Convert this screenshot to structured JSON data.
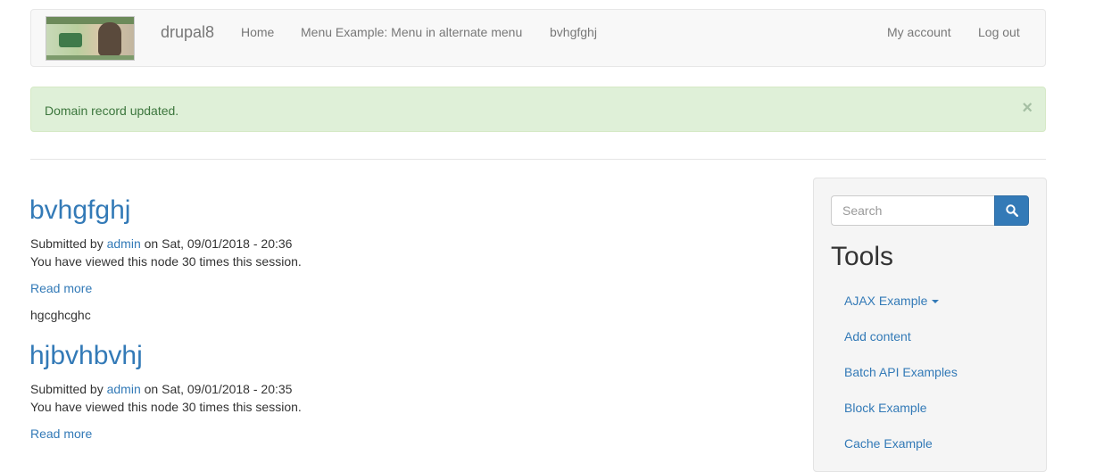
{
  "navbar": {
    "brand": "drupal8",
    "links": [
      "Home",
      "Menu Example: Menu in alternate menu",
      "bvhgfghj"
    ],
    "account_links": [
      "My account",
      "Log out"
    ]
  },
  "alert": {
    "message": "Domain record updated.",
    "close": "×"
  },
  "nodes": [
    {
      "title": "bvhgfghj",
      "submitted_prefix": "Submitted by ",
      "author": "admin",
      "submitted_suffix": " on Sat, 09/01/2018 - 20:36",
      "views": "You have viewed this node 30 times this session.",
      "read_more": "Read more",
      "body": "hgcghcghc"
    },
    {
      "title": "hjbvhbvhj",
      "submitted_prefix": "Submitted by ",
      "author": "admin",
      "submitted_suffix": " on Sat, 09/01/2018 - 20:35",
      "views": "You have viewed this node 30 times this session.",
      "read_more": "Read more"
    }
  ],
  "sidebar": {
    "search_placeholder": "Search",
    "search_icon": "search-icon",
    "tools_heading": "Tools",
    "tools": [
      "AJAX Example",
      "Add content",
      "Batch API Examples",
      "Block Example",
      "Cache Example"
    ]
  },
  "colors": {
    "link": "#337ab7",
    "navbar_bg": "#f8f8f8",
    "alert_bg": "#dff0d8",
    "alert_text": "#3c763d",
    "sidebar_bg": "#f5f5f5"
  }
}
